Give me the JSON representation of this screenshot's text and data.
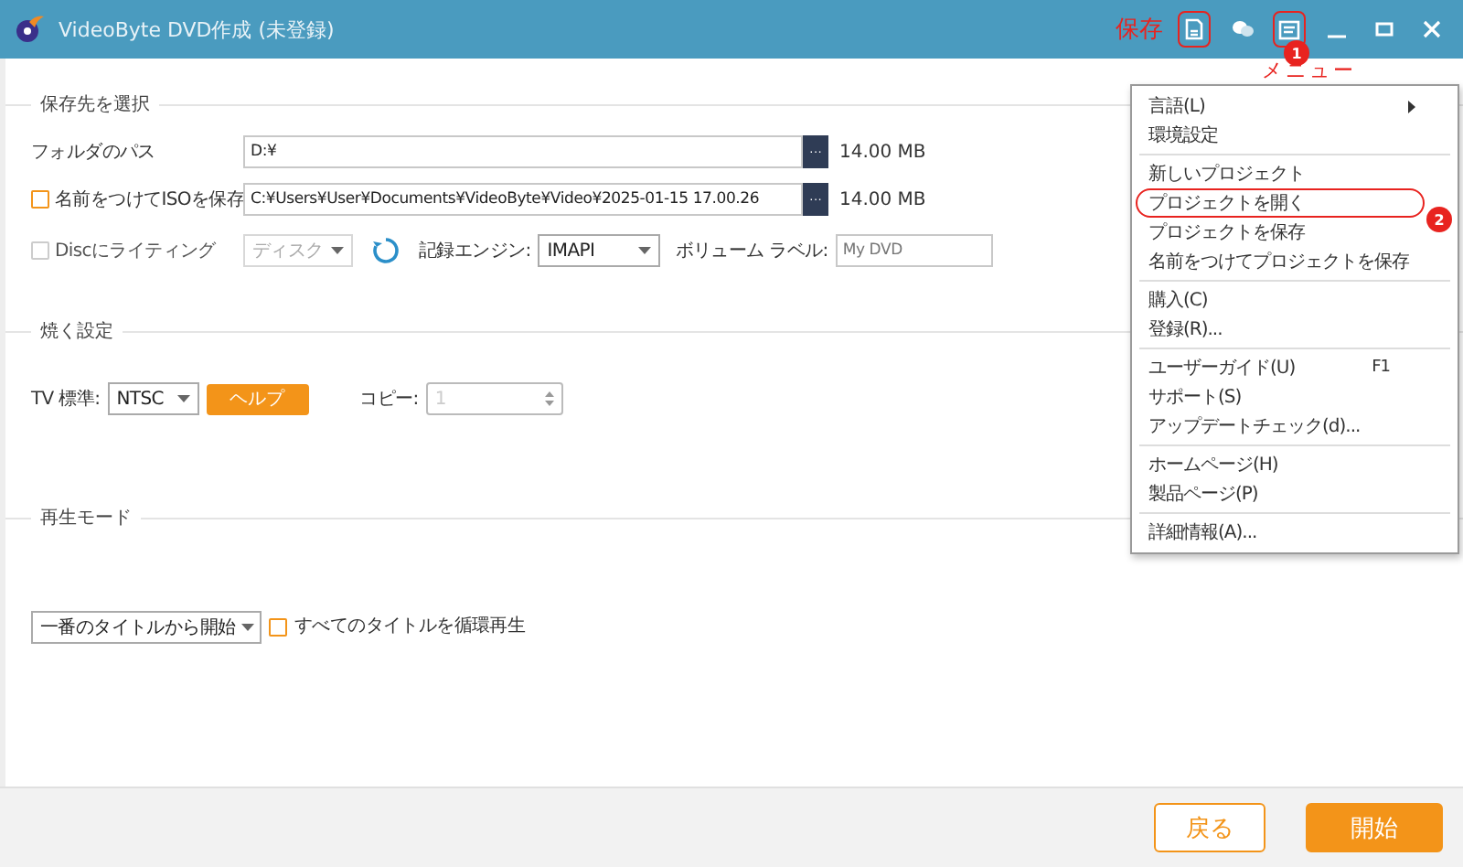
{
  "window": {
    "title": "VideoByte DVD作成 (未登録)"
  },
  "title_bar": {
    "annotation_label": "保存",
    "tools": [
      {
        "kind": "save",
        "highlighted": true
      },
      {
        "kind": "chat",
        "highlighted": false
      },
      {
        "kind": "menu",
        "highlighted": true,
        "badge": "1"
      }
    ],
    "menu_annotation_label": "メニュー"
  },
  "destination": {
    "heading": "保存先を選択",
    "folder": {
      "label": "フォルダのパス",
      "value": "D:¥",
      "browse": "···",
      "size": "14.00 MB"
    },
    "iso": {
      "label": "名前をつけてISOを保存",
      "checked": false,
      "disabled": false,
      "value": "C:¥Users¥User¥Documents¥VideoByte¥Video¥2025-01-15 17.00.26",
      "browse": "···",
      "size": "14.00 MB"
    },
    "disc": {
      "label": "Discにライティング",
      "checked": false,
      "disabled": true,
      "drive": "ディスク",
      "engine_label": "記録エンジン:",
      "engine": "IMAPI",
      "volume_label": "ボリューム ラベル:",
      "volume_placeholder": "My DVD"
    }
  },
  "burn": {
    "heading": "焼く設定",
    "tv_label": "TV 標準:",
    "tv_value": "NTSC",
    "help_button": "ヘルプ",
    "copy_label": "コピー:",
    "copy_value": "1"
  },
  "playback": {
    "heading": "再生モード",
    "mode": "一番のタイトルから開始",
    "loop": {
      "label": "すべてのタイトルを循環再生",
      "checked": false
    }
  },
  "footer": {
    "buttons": [
      {
        "label": "戻る",
        "kind": "secondary"
      },
      {
        "label": "開始",
        "kind": "primary"
      }
    ]
  },
  "menu": {
    "groups": [
      [
        {
          "label": "言語(L)",
          "submenu": true,
          "highlighted": false
        },
        {
          "label": "環境設定",
          "highlighted": false
        }
      ],
      [
        {
          "label": "新しいプロジェクト",
          "highlighted": false
        },
        {
          "label": "プロジェクトを開く",
          "highlighted": true,
          "badge": "2"
        },
        {
          "label": "プロジェクトを保存",
          "highlighted": false
        },
        {
          "label": "名前をつけてプロジェクトを保存",
          "highlighted": false
        }
      ],
      [
        {
          "label": "購入(C)",
          "highlighted": false
        },
        {
          "label": "登録(R)...",
          "highlighted": false
        }
      ],
      [
        {
          "label": "ユーザーガイド(U)",
          "shortcut": "F1",
          "highlighted": false
        },
        {
          "label": "サポート(S)",
          "highlighted": false
        },
        {
          "label": "アップデートチェック(d)...",
          "highlighted": false
        }
      ],
      [
        {
          "label": "ホームページ(H)",
          "highlighted": false
        },
        {
          "label": "製品ページ(P)",
          "highlighted": false
        }
      ],
      [
        {
          "label": "詳細情報(A)...",
          "highlighted": false
        }
      ]
    ]
  }
}
